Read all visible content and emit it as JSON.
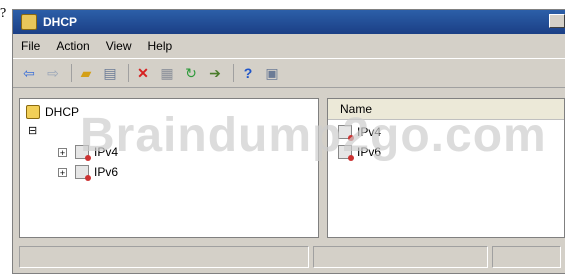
{
  "stray_mark": "?",
  "window": {
    "title": "DHCP"
  },
  "menu": [
    "File",
    "Action",
    "View",
    "Help"
  ],
  "toolbar": {
    "buttons": [
      "back-icon",
      "forward-icon",
      "up-folder-icon",
      "show-hide-tree-icon",
      "delete-icon",
      "properties-icon",
      "refresh-icon",
      "export-icon",
      "help-icon",
      "console-icon"
    ]
  },
  "tree": {
    "root_label": "DHCP",
    "items": [
      {
        "label": "IPv4",
        "expander": "+"
      },
      {
        "label": "IPv6",
        "expander": "+"
      }
    ],
    "collapse_glyph": "⊟"
  },
  "list": {
    "column_name": "Name",
    "rows": [
      {
        "label": "IPv4"
      },
      {
        "label": "IPv6"
      }
    ]
  },
  "watermark": "Braindump2go.com",
  "colors": {
    "titlebar": "#1b3f86",
    "watermark": "#cdcdcd"
  }
}
